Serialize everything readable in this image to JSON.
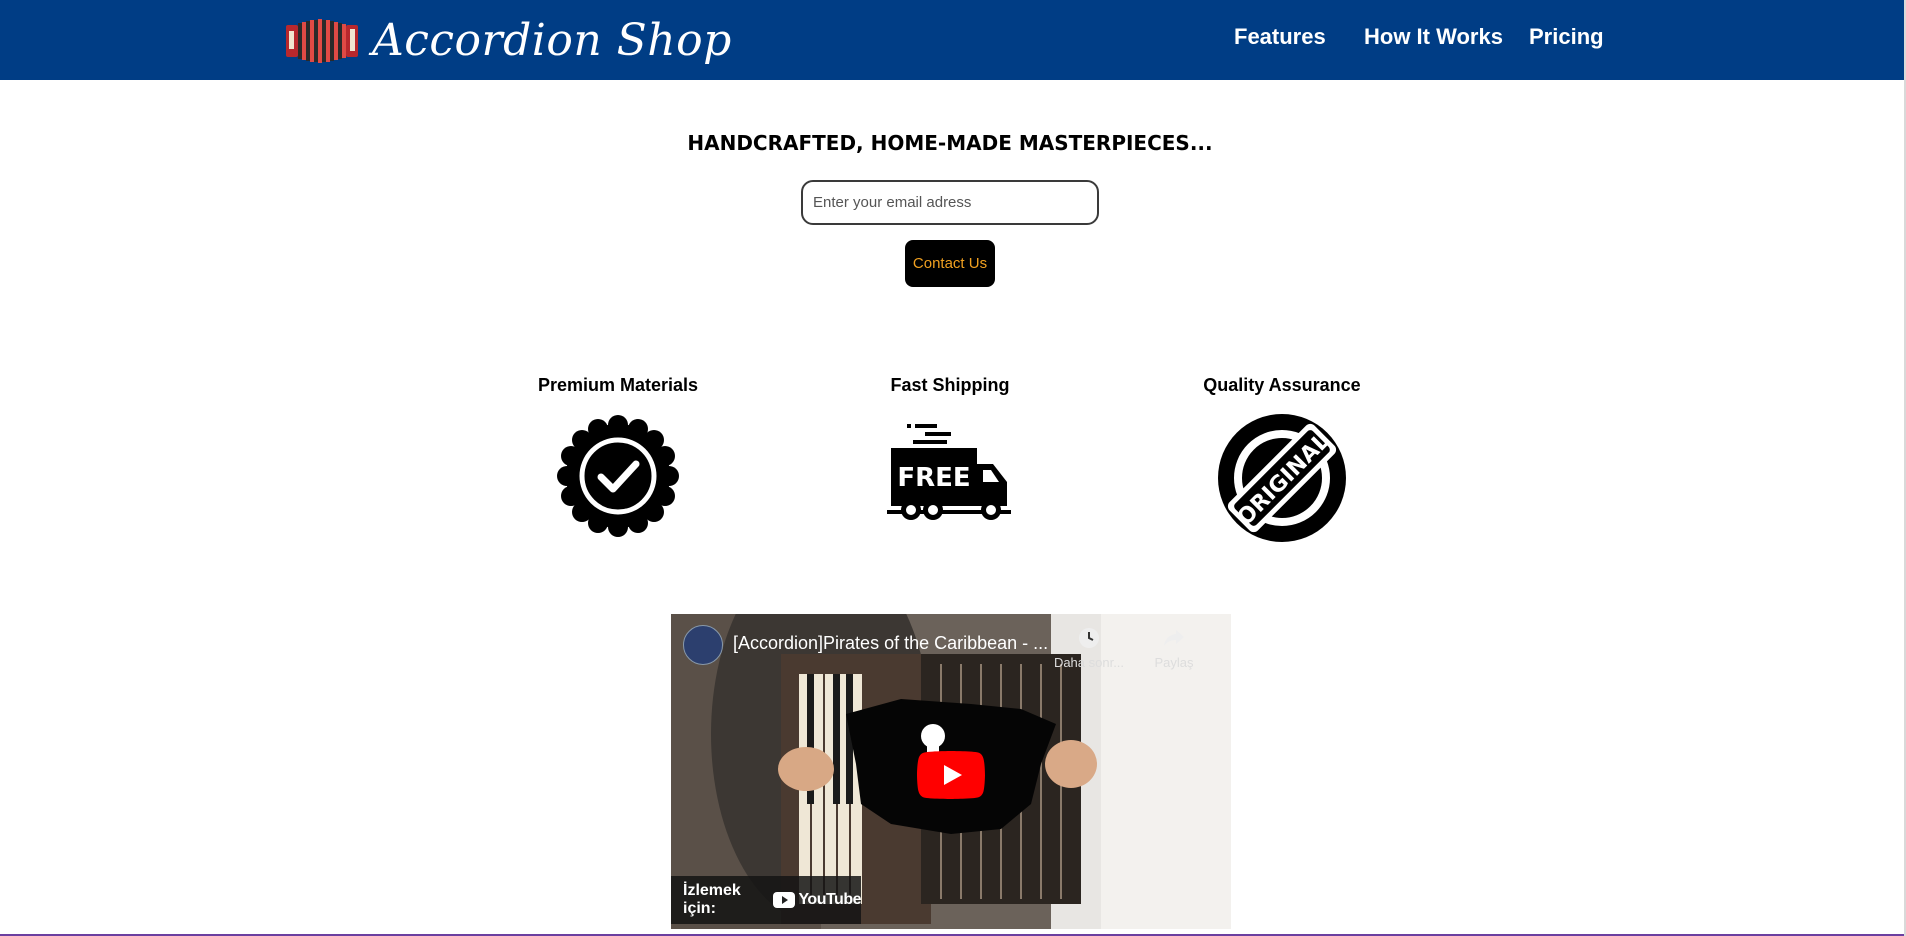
{
  "header": {
    "brand_name": "Accordion Shop",
    "logo_icon": "accordion-icon",
    "bg_color": "#003d85",
    "nav": [
      {
        "label": "Features"
      },
      {
        "label": "How It Works"
      },
      {
        "label": "Pricing"
      }
    ]
  },
  "hero": {
    "title": "HANDCRAFTED, HOME-MADE MASTERPIECES...",
    "email_placeholder": "Enter your email adress",
    "contact_label": "Contact Us",
    "button_text_color": "#f0a020"
  },
  "features": [
    {
      "title": "Premium Materials",
      "icon": "badge-check-icon"
    },
    {
      "title": "Fast Shipping",
      "icon": "free-shipping-truck-icon"
    },
    {
      "title": "Quality Assurance",
      "icon": "original-stamp-icon"
    }
  ],
  "free_text": "FREE",
  "original_text": "ORIGINAL",
  "video": {
    "title": "[Accordion]Pirates of the Caribbean - ...",
    "watch_later_label": "Daha sonr...",
    "share_label": "Paylaş",
    "watch_on_label": "İzlemek için:",
    "youtube_label": "YouTube"
  }
}
